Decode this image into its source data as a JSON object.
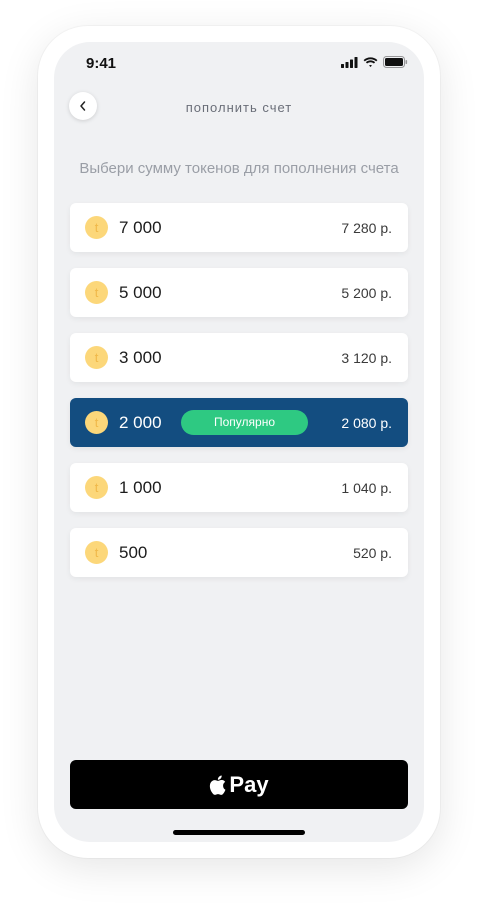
{
  "status_bar": {
    "time": "9:41"
  },
  "header": {
    "title": "пополнить счет"
  },
  "subtitle": "Выбери сумму токенов для пополнения счета",
  "packages": [
    {
      "amount": "7 000",
      "price": "7 280 р.",
      "badge": "",
      "selected": false
    },
    {
      "amount": "5 000",
      "price": "5 200 р.",
      "badge": "",
      "selected": false
    },
    {
      "amount": "3 000",
      "price": "3 120 р.",
      "badge": "",
      "selected": false
    },
    {
      "amount": "2 000",
      "price": "2 080 р.",
      "badge": "Популярно",
      "selected": true
    },
    {
      "amount": "1 000",
      "price": "1 040 р.",
      "badge": "",
      "selected": false
    },
    {
      "amount": "500",
      "price": "520 р.",
      "badge": "",
      "selected": false
    }
  ],
  "coin_glyph": "t",
  "pay_button": {
    "label": "Pay",
    "icon": "apple-icon"
  },
  "colors": {
    "background": "#f0f1f3",
    "selected_row": "#134d80",
    "badge": "#2ec982",
    "coin": "#fcd77a",
    "pay_button": "#000000"
  }
}
